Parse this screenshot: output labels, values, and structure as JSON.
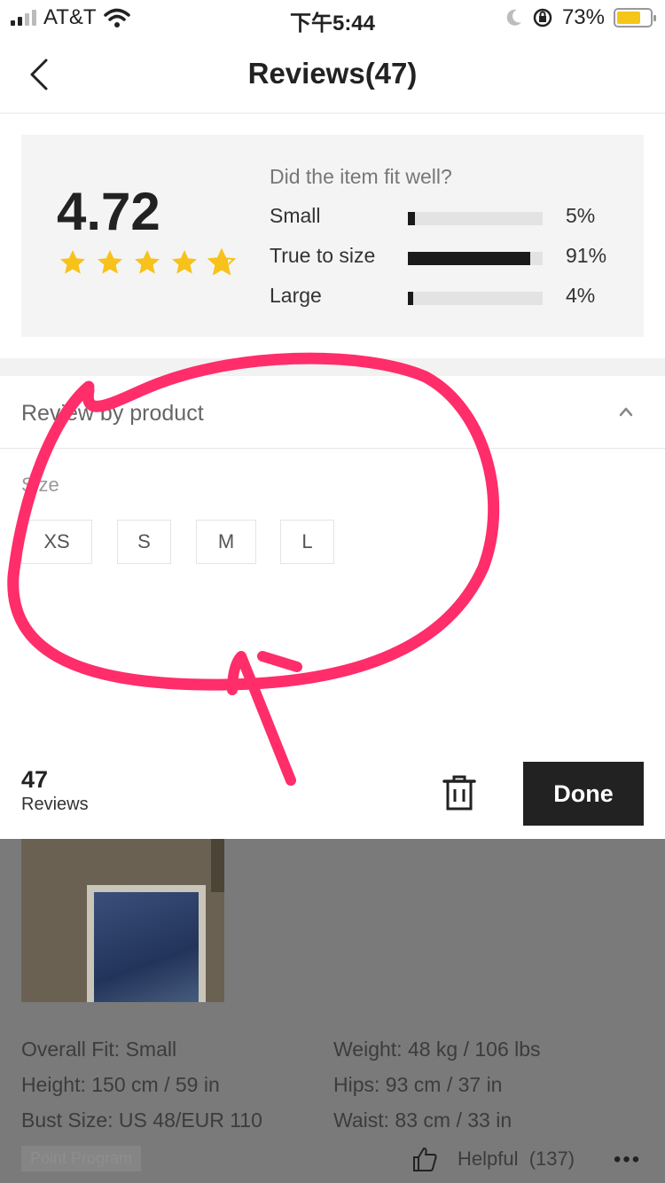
{
  "status_bar": {
    "carrier": "AT&T",
    "time": "下午5:44",
    "battery_pct": "73%",
    "battery_level": 0.73,
    "icons": [
      "signal-icon",
      "wifi-icon",
      "moon-icon",
      "orientation-lock-icon",
      "battery-icon"
    ]
  },
  "nav": {
    "title": "Reviews(47)",
    "back_icon": "chevron-left-icon"
  },
  "rating": {
    "score": "4.72",
    "stars": 4.72,
    "fit_question": "Did the item fit well?",
    "fit": [
      {
        "label": "Small",
        "pct": "5%",
        "value": 0.05
      },
      {
        "label": "True to size",
        "pct": "91%",
        "value": 0.91
      },
      {
        "label": "Large",
        "pct": "4%",
        "value": 0.04
      }
    ]
  },
  "review_by_product": {
    "title": "Review by product",
    "size_label": "Size",
    "sizes": [
      "XS",
      "S",
      "M",
      "L"
    ]
  },
  "action_bar": {
    "count": "47",
    "count_label": "Reviews",
    "done_label": "Done",
    "trash_icon": "trash-icon"
  },
  "review": {
    "details_left": [
      "Overall Fit: Small",
      "Height: 150 cm / 59 in",
      "Bust Size: US 48/EUR 110"
    ],
    "details_right": [
      "Weight: 48 kg / 106 lbs",
      "Hips: 93 cm / 37 in",
      "Waist: 83 cm / 33 in"
    ],
    "tag": "Point Program",
    "helpful_label": "Helpful",
    "helpful_count": "(137)",
    "more": "•••"
  },
  "colors": {
    "annotation": "#ff2d6a",
    "dark": "#222222",
    "star": "#f7c21b"
  }
}
